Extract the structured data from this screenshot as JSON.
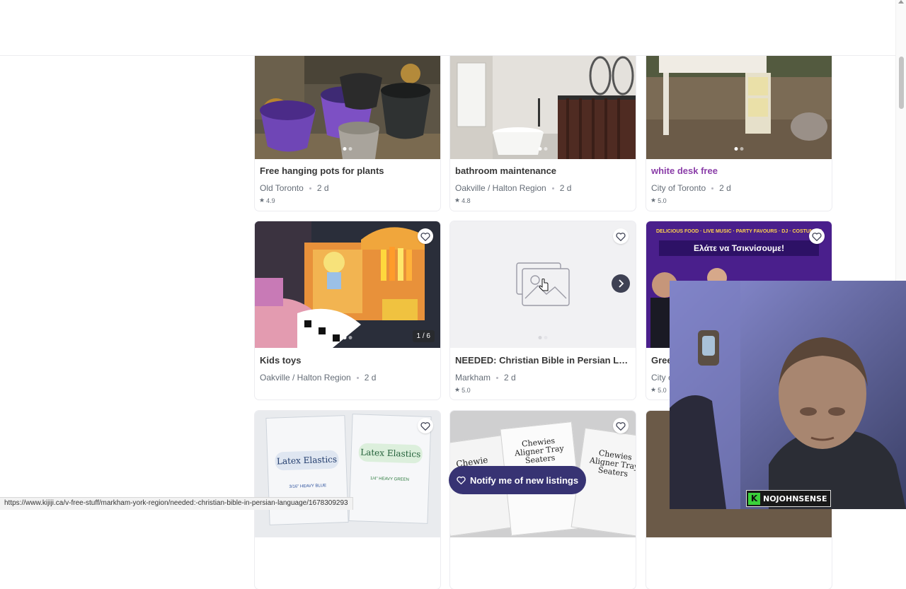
{
  "listings": [
    {
      "title": "Free hanging pots for plants",
      "location": "Old Toronto",
      "age": "2 d",
      "rating": "4.9",
      "visited": false
    },
    {
      "title": "bathroom maintenance",
      "location": "Oakville / Halton Region",
      "age": "2 d",
      "rating": "4.8",
      "visited": false
    },
    {
      "title": "white desk free",
      "location": "City of Toronto",
      "age": "2 d",
      "rating": "5.0",
      "visited": true
    },
    {
      "title": "Kids toys",
      "location": "Oakville / Halton Region",
      "age": "2 d",
      "rating": "",
      "counter": "1 / 6"
    },
    {
      "title": "NEEDED: Christian Bible in Persian Lang...",
      "location": "Markham",
      "age": "2 d",
      "rating": "5.0"
    },
    {
      "title": "Gree",
      "location": "City c",
      "age": "",
      "rating": "5.0",
      "promo_text": "Ελάτε να Τσικνίσουμε!",
      "promo_banner": "DELICIOUS FOOD · LIVE MUSIC · PARTY FAVOURS · DJ · COSTUME P"
    }
  ],
  "bottom_row": [
    {
      "pack1": "Latex Elastics",
      "pack2": "Latex Elastics",
      "pack1_sub": "3/16\" HEAVY  BLUE",
      "pack2_sub": "1/4\" HEAVY  GREEN"
    },
    {
      "pack_left": "Chewie",
      "pack_mid": "Chewies Aligner Tray Seaters",
      "pack_right": "Chewies Aligner Tray Seaters"
    }
  ],
  "notify_button": {
    "label": "Notify me of new listings"
  },
  "status_url": "https://www.kijiji.ca/v-free-stuff/markham-york-region/needed:-christian-bible-in-persian-language/1678309293",
  "webcam": {
    "badge_text": "NOJOHNSENSE",
    "badge_logo": "K"
  },
  "colors": {
    "visited_title": "#8a3da8",
    "notify_bg": "#373373",
    "badge_green": "#3ad13a"
  }
}
